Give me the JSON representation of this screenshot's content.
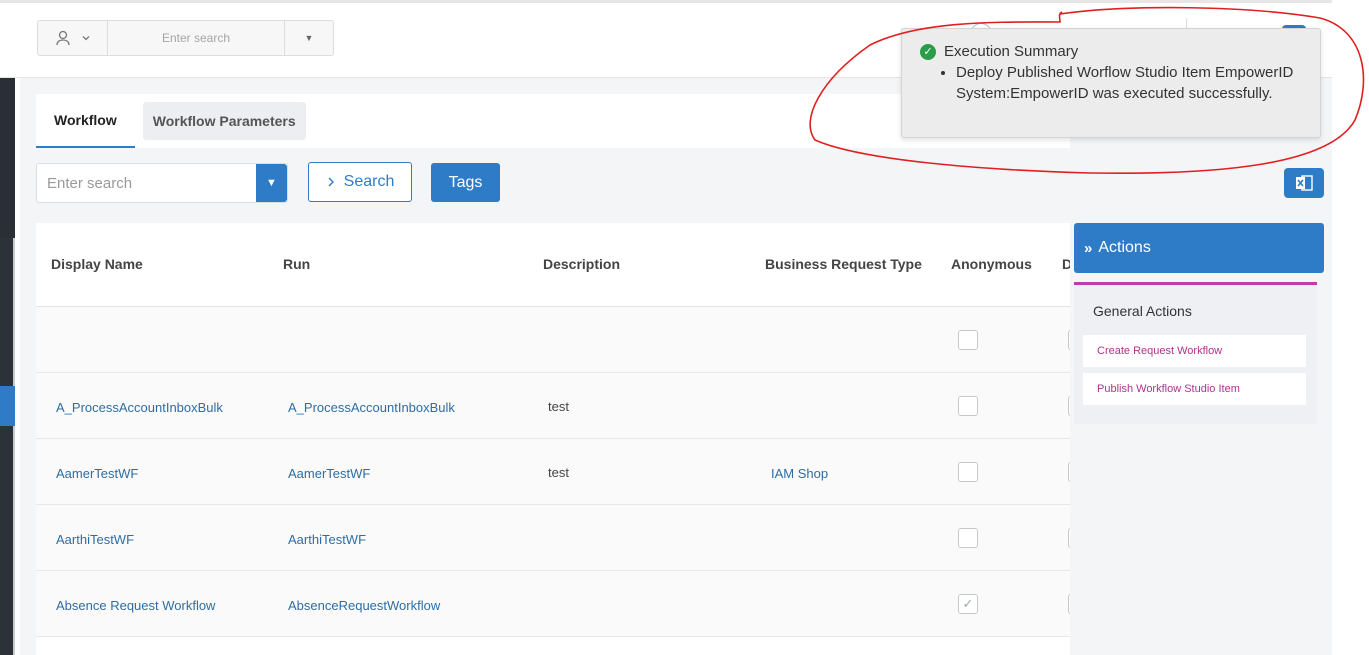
{
  "header": {
    "search_placeholder": "Enter search"
  },
  "tabs": [
    {
      "label": "Workflow"
    },
    {
      "label": "Workflow Parameters"
    }
  ],
  "toolbar": {
    "search_placeholder": "Enter search",
    "search_label": "Search",
    "tags_label": "Tags"
  },
  "grid": {
    "columns": [
      "Display Name",
      "Run",
      "Description",
      "Business Request Type",
      "Anonymous",
      "D"
    ],
    "rows": [
      {
        "display_name": "",
        "run": "",
        "description": "",
        "business_request_type": "",
        "anonymous": false
      },
      {
        "display_name": "A_ProcessAccountInboxBulk",
        "run": "A_ProcessAccountInboxBulk",
        "description": "test",
        "business_request_type": "",
        "anonymous": false
      },
      {
        "display_name": "AamerTestWF",
        "run": "AamerTestWF",
        "description": "test",
        "business_request_type": "IAM Shop",
        "anonymous": false
      },
      {
        "display_name": "AarthiTestWF",
        "run": "AarthiTestWF",
        "description": "",
        "business_request_type": "",
        "anonymous": false
      },
      {
        "display_name": "Absence Request Workflow",
        "run": "AbsenceRequestWorkflow",
        "description": "",
        "business_request_type": "",
        "anonymous": true
      }
    ]
  },
  "actions": {
    "title": "Actions",
    "section_title": "General Actions",
    "items": [
      "Create Request Workflow",
      "Publish Workflow Studio Item"
    ]
  },
  "toast": {
    "title": "Execution Summary",
    "message": "Deploy Published Worflow Studio Item EmpowerID System:EmpowerID was executed successfully."
  },
  "colors": {
    "primary": "#2e7cc7",
    "link": "#2e6da4",
    "action_link": "#b0328e",
    "accent_bar": "#c03ca9",
    "success": "#2a9d4a",
    "annotation": "#e02020"
  }
}
